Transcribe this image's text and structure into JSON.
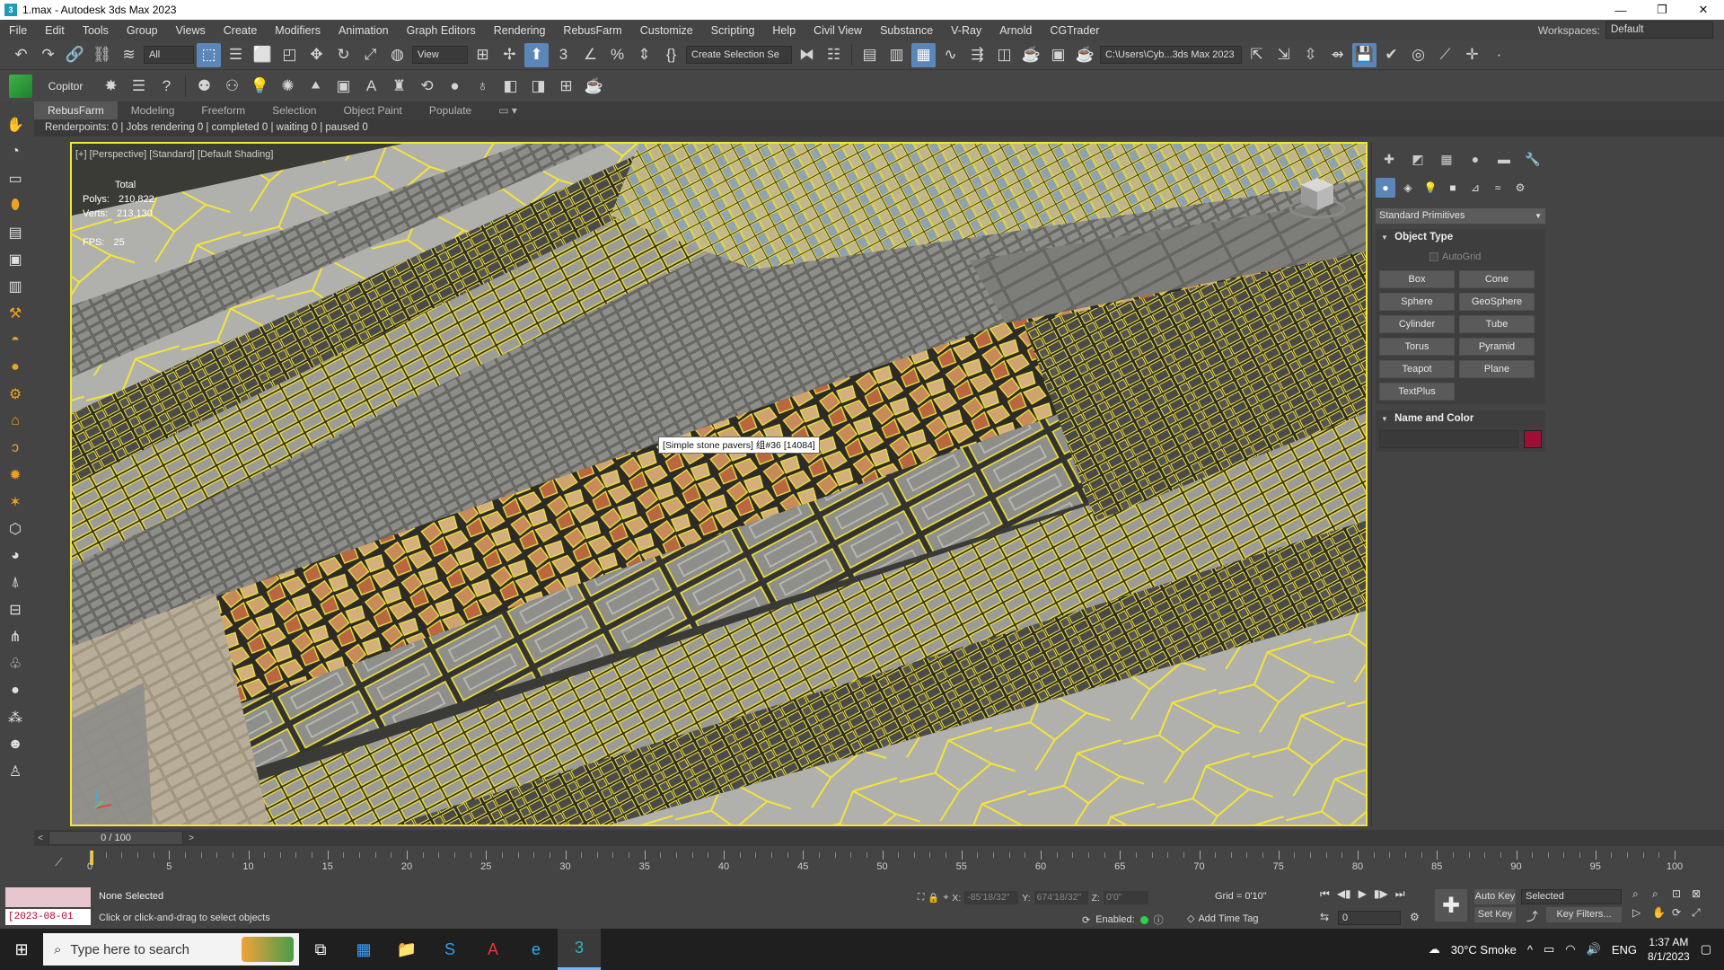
{
  "window": {
    "title": "1.max - Autodesk 3ds Max 2023",
    "app_icon_text": "3",
    "minimize_glyph": "—",
    "restore_glyph": "❐",
    "close_glyph": "✕"
  },
  "menubar": {
    "items": [
      "File",
      "Edit",
      "Tools",
      "Group",
      "Views",
      "Create",
      "Modifiers",
      "Animation",
      "Graph Editors",
      "Rendering",
      "RebusFarm",
      "Customize",
      "Scripting",
      "Help",
      "Civil View",
      "Substance",
      "V-Ray",
      "Arnold",
      "CGTrader"
    ],
    "workspace_label": "Workspaces:",
    "workspace_value": "Default"
  },
  "toolbar": {
    "filter_value": "All",
    "refcoord_value": "View",
    "named_selection_placeholder": "Create Selection Se",
    "project_path": "C:\\Users\\Cyb...3ds Max 2023"
  },
  "toolbar2": {
    "copitor_label": "Copitor"
  },
  "ribbon": {
    "tabs": [
      "RebusFarm",
      "Modeling",
      "Freeform",
      "Selection",
      "Object Paint",
      "Populate"
    ]
  },
  "render_status": "Renderpoints: 0 | Jobs rendering 0 | completed 0 | waiting 0 | paused 0",
  "viewport": {
    "label": "[+] [Perspective] [Standard] [Default Shading]",
    "stats": {
      "header": "Total",
      "polys_label": "Polys:",
      "polys_value": "210,822",
      "verts_label": "Verts:",
      "verts_value": "213,130",
      "fps_label": "FPS:",
      "fps_value": "25"
    },
    "tooltip": "[Simple stone pavers] 组#36 [14084]"
  },
  "command_panel": {
    "category": "Standard Primitives",
    "object_type_title": "Object Type",
    "autogrid_label": "AutoGrid",
    "primitives": [
      "Box",
      "Cone",
      "Sphere",
      "GeoSphere",
      "Cylinder",
      "Tube",
      "Torus",
      "Pyramid",
      "Teapot",
      "Plane",
      "TextPlus"
    ],
    "name_color_title": "Name and Color",
    "object_color": "#9e0f35"
  },
  "timeslider": {
    "position_text": "0 / 100"
  },
  "trackbar": {
    "labels": [
      "0",
      "5",
      "10",
      "15",
      "20",
      "25",
      "30",
      "35",
      "40",
      "45",
      "50",
      "55",
      "60",
      "65",
      "70",
      "75",
      "80",
      "85",
      "90",
      "95",
      "100"
    ]
  },
  "statusbar": {
    "date": "[2023-08-01",
    "selection": "None Selected",
    "prompt": "Click or click-and-drag to select objects",
    "x_label": "X:",
    "x_value": "-85'18/32\"",
    "y_label": "Y:",
    "y_value": "674'18/32\"",
    "z_label": "Z:",
    "z_value": "0'0\"",
    "grid": "Grid = 0'10\"",
    "enabled_label": "Enabled:",
    "add_time_tag": "Add Time Tag",
    "frame_value": "0",
    "auto_key": "Auto Key",
    "set_key": "Set Key",
    "selected_value": "Selected",
    "key_filters": "Key Filters..."
  },
  "taskbar": {
    "search_placeholder": "Type here to search",
    "weather": "30°C  Smoke",
    "lang": "ENG",
    "time": "1:37 AM",
    "date": "8/1/2023"
  },
  "colors": {
    "selection_highlight": "#f4e43a",
    "accent_blue": "#5b87b8",
    "enabled_green": "#2fd14b"
  }
}
